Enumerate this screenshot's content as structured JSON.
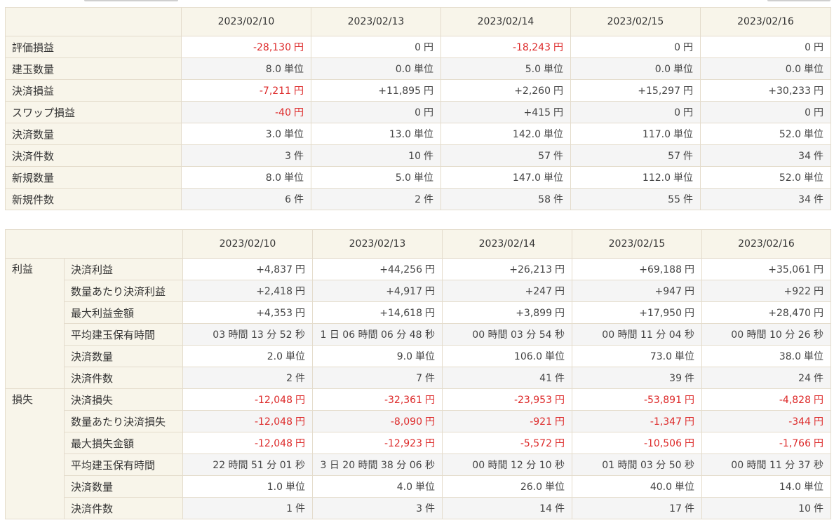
{
  "dates": [
    "2023/02/10",
    "2023/02/13",
    "2023/02/14",
    "2023/02/15",
    "2023/02/16"
  ],
  "summary": [
    {
      "label": "評価損益",
      "unit": "円",
      "values": [
        "-28,130",
        "0",
        "-18,243",
        "0",
        "0"
      ],
      "neg": [
        true,
        false,
        true,
        false,
        false
      ]
    },
    {
      "label": "建玉数量",
      "unit": "単位",
      "values": [
        "8.0",
        "0.0",
        "5.0",
        "0.0",
        "0.0"
      ],
      "neg": [
        false,
        false,
        false,
        false,
        false
      ]
    },
    {
      "label": "決済損益",
      "unit": "円",
      "values": [
        "-7,211",
        "+11,895",
        "+2,260",
        "+15,297",
        "+30,233"
      ],
      "neg": [
        true,
        false,
        false,
        false,
        false
      ]
    },
    {
      "label": "スワップ損益",
      "unit": "円",
      "values": [
        "-40",
        "0",
        "+415",
        "0",
        "0"
      ],
      "neg": [
        true,
        false,
        false,
        false,
        false
      ]
    },
    {
      "label": "決済数量",
      "unit": "単位",
      "values": [
        "3.0",
        "13.0",
        "142.0",
        "117.0",
        "52.0"
      ],
      "neg": [
        false,
        false,
        false,
        false,
        false
      ]
    },
    {
      "label": "決済件数",
      "unit": "件",
      "values": [
        "3",
        "10",
        "57",
        "57",
        "34"
      ],
      "neg": [
        false,
        false,
        false,
        false,
        false
      ]
    },
    {
      "label": "新規数量",
      "unit": "単位",
      "values": [
        "8.0",
        "5.0",
        "147.0",
        "112.0",
        "52.0"
      ],
      "neg": [
        false,
        false,
        false,
        false,
        false
      ]
    },
    {
      "label": "新規件数",
      "unit": "件",
      "values": [
        "6",
        "2",
        "58",
        "55",
        "34"
      ],
      "neg": [
        false,
        false,
        false,
        false,
        false
      ]
    }
  ],
  "detail": {
    "profit_group": "利益",
    "loss_group": "損失",
    "profit_rows": [
      {
        "label": "決済利益",
        "unit": "円",
        "values": [
          "+4,837",
          "+44,256",
          "+26,213",
          "+69,188",
          "+35,061"
        ],
        "neg": false
      },
      {
        "label": "数量あたり決済利益",
        "unit": "円",
        "values": [
          "+2,418",
          "+4,917",
          "+247",
          "+947",
          "+922"
        ],
        "neg": false
      },
      {
        "label": "最大利益金額",
        "unit": "円",
        "values": [
          "+4,353",
          "+14,618",
          "+3,899",
          "+17,950",
          "+28,470"
        ],
        "neg": false
      },
      {
        "label": "平均建玉保有時間",
        "unit": "",
        "values": [
          "03 時間 13 分 52 秒",
          "1 日 06 時間 06 分 48 秒",
          "00 時間 03 分 54 秒",
          "00 時間 11 分 04 秒",
          "00 時間 10 分 26 秒"
        ],
        "neg": false
      },
      {
        "label": "決済数量",
        "unit": "単位",
        "values": [
          "2.0",
          "9.0",
          "106.0",
          "73.0",
          "38.0"
        ],
        "neg": false
      },
      {
        "label": "決済件数",
        "unit": "件",
        "values": [
          "2",
          "7",
          "41",
          "39",
          "24"
        ],
        "neg": false
      }
    ],
    "loss_rows": [
      {
        "label": "決済損失",
        "unit": "円",
        "values": [
          "-12,048",
          "-32,361",
          "-23,953",
          "-53,891",
          "-4,828"
        ],
        "neg": true
      },
      {
        "label": "数量あたり決済損失",
        "unit": "円",
        "values": [
          "-12,048",
          "-8,090",
          "-921",
          "-1,347",
          "-344"
        ],
        "neg": true
      },
      {
        "label": "最大損失金額",
        "unit": "円",
        "values": [
          "-12,048",
          "-12,923",
          "-5,572",
          "-10,506",
          "-1,766"
        ],
        "neg": true
      },
      {
        "label": "平均建玉保有時間",
        "unit": "",
        "values": [
          "22 時間 51 分 01 秒",
          "3 日 20 時間 38 分 06 秒",
          "00 時間 12 分 10 秒",
          "01 時間 03 分 50 秒",
          "00 時間 11 分 37 秒"
        ],
        "neg": false
      },
      {
        "label": "決済数量",
        "unit": "単位",
        "values": [
          "1.0",
          "4.0",
          "26.0",
          "40.0",
          "14.0"
        ],
        "neg": false
      },
      {
        "label": "決済件数",
        "unit": "件",
        "values": [
          "1",
          "3",
          "14",
          "17",
          "10"
        ],
        "neg": false
      }
    ]
  },
  "colors": {
    "negative": "#dd2a2a",
    "header_bg": "#f8f5ea",
    "alt_row": "#f5f5f5",
    "border": "#e4dccc"
  }
}
